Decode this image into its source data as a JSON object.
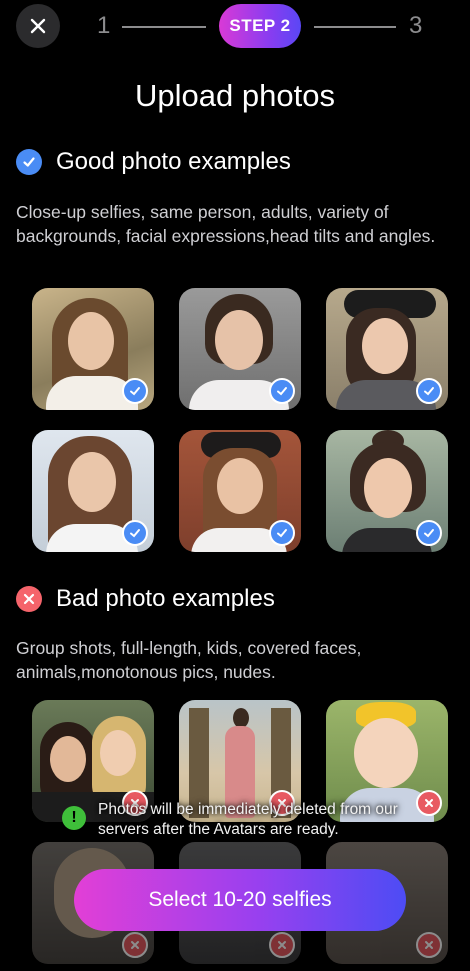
{
  "stepper": {
    "step1": "1",
    "step2": "STEP 2",
    "step3": "3"
  },
  "title": "Upload photos",
  "good": {
    "heading": "Good photo examples",
    "description": "Close-up selfies, same person, adults, variety of backgrounds, facial expressions,head tilts and angles."
  },
  "bad": {
    "heading": "Bad photo examples",
    "description": "Group shots, full-length, kids, covered faces, animals,monotonous pics, nudes."
  },
  "toast": {
    "icon": "!",
    "text": "Photos will be immediately deleted from our servers after the Avatars are ready."
  },
  "cta": {
    "label": "Select 10-20 selfies"
  },
  "colors": {
    "accent_blue": "#4a8cf5",
    "accent_red": "#f5646b",
    "gradient_start": "#e23fd6",
    "gradient_end": "#4d4cf4",
    "info_green": "#3fbf3a"
  }
}
